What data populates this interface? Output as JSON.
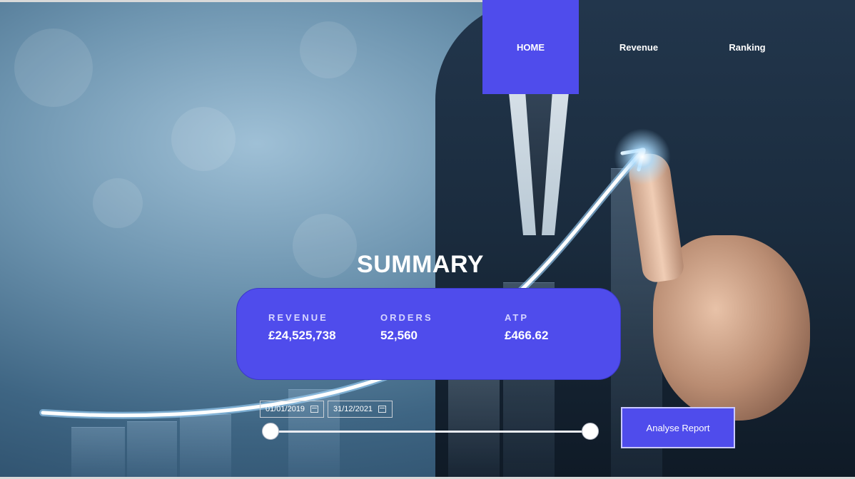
{
  "nav": {
    "home": "HOME",
    "revenue": "Revenue",
    "ranking": "Ranking"
  },
  "summary": {
    "title": "SUMMARY",
    "kpis": [
      {
        "label": "REVENUE",
        "value": "£24,525,738"
      },
      {
        "label": "ORDERS",
        "value": "52,560"
      },
      {
        "label": "ATP",
        "value": "£466.62"
      }
    ]
  },
  "date_range": {
    "start": "01/01/2019",
    "end": "31/12/2021"
  },
  "analyse_button": "Analyse Report",
  "colors": {
    "accent": "#4f4cec",
    "text": "#ffffff"
  }
}
